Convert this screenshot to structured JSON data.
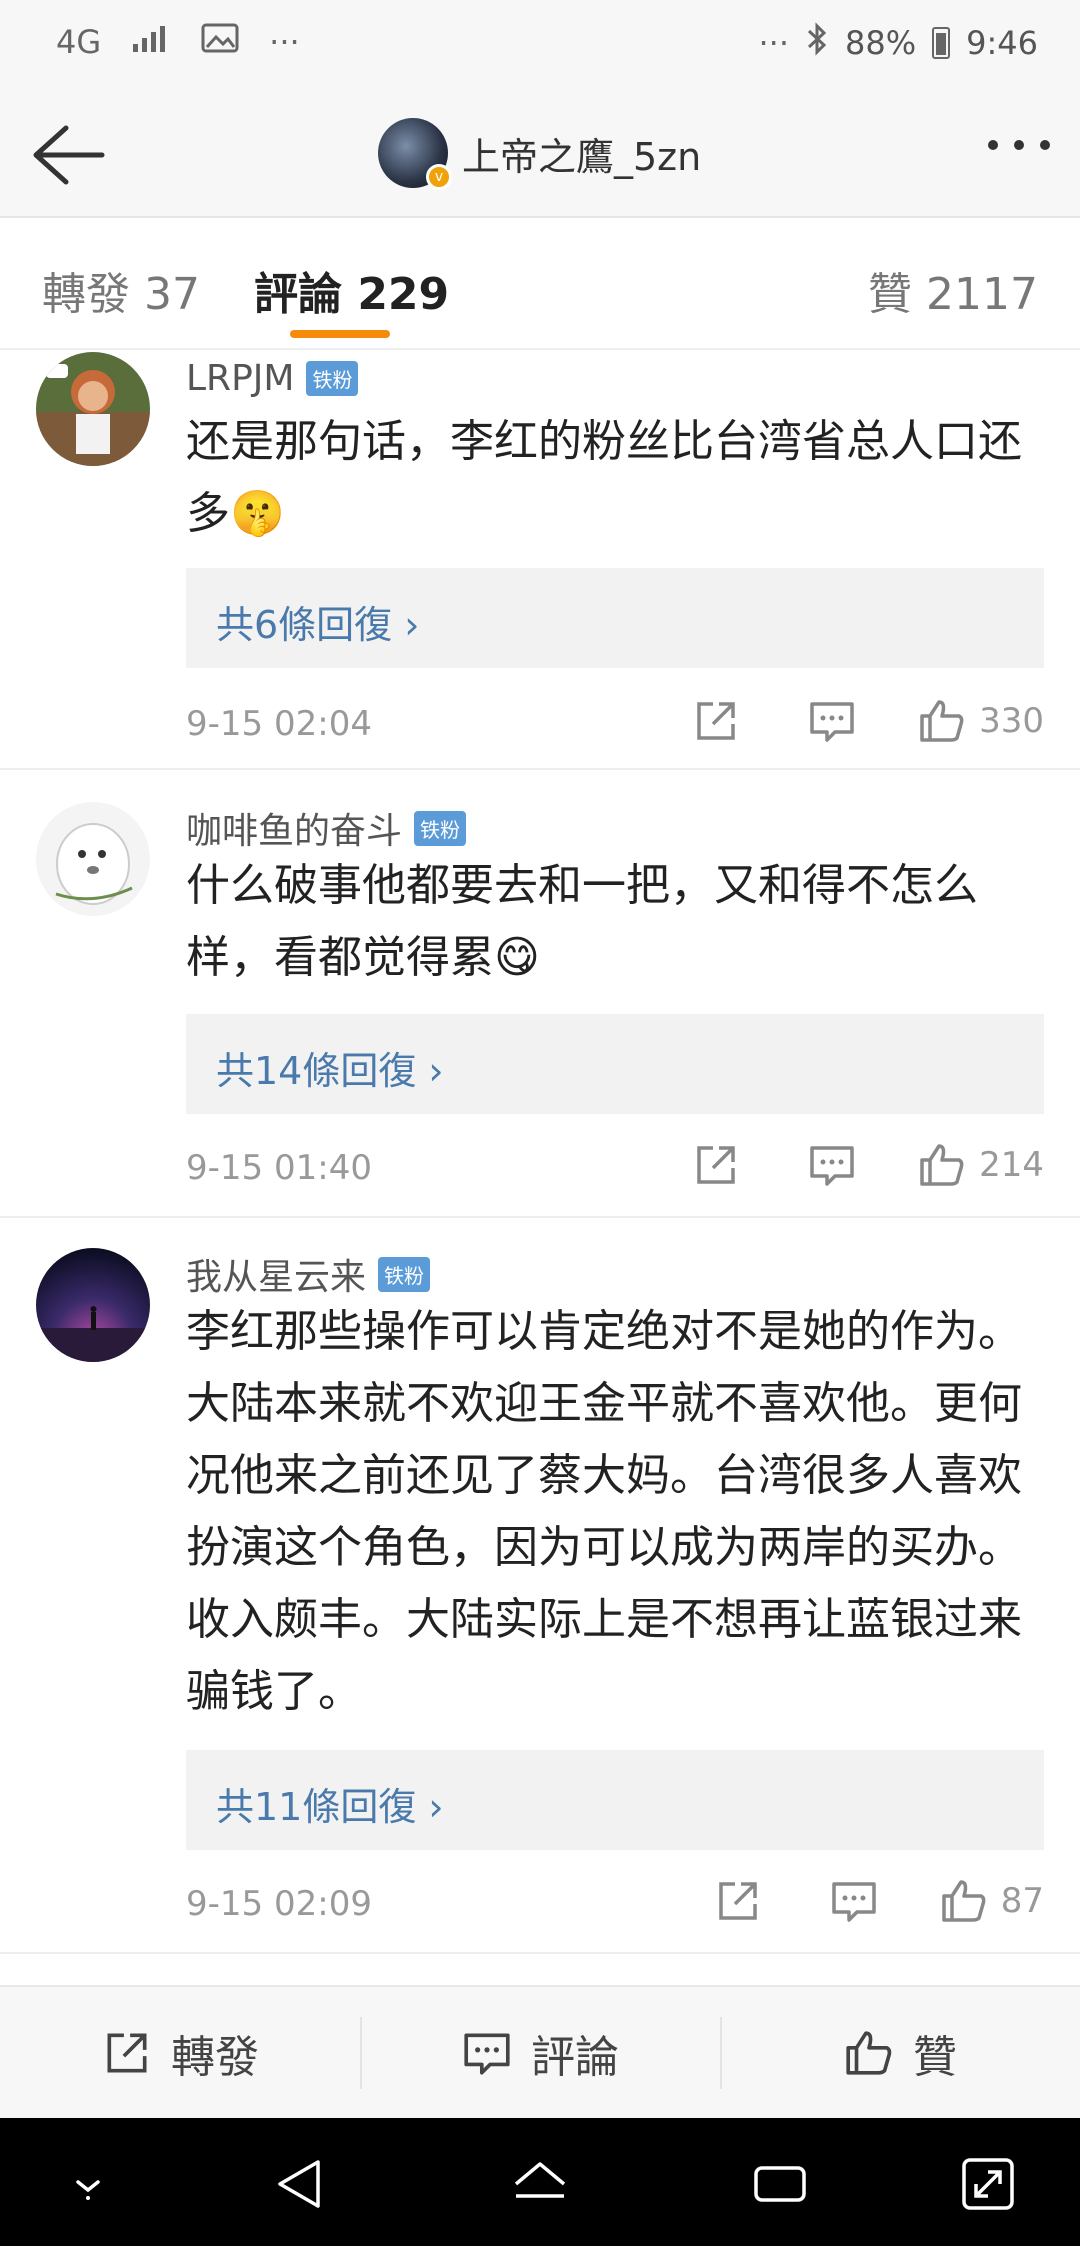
{
  "status_bar": {
    "network": "4G",
    "battery": "88%",
    "time": "9:46",
    "icons": [
      "signal-icon",
      "image-icon",
      "more-icon",
      "bluetooth-icon",
      "battery-icon"
    ]
  },
  "nav": {
    "title": "上帝之鷹_5zn",
    "back_icon": "back-arrow-icon",
    "more_icon": "more-dots-icon"
  },
  "tabs": {
    "reposts": "轉發 37",
    "comments": "評論 229",
    "likes": "贊 2117"
  },
  "comments": [
    {
      "name": "LRPJM",
      "badge": "铁粉",
      "line1": "还是那句话，李红的粉丝比台湾省总人口还",
      "line2": "多",
      "emoji": "🤫",
      "replies": "共6條回復 ›",
      "time": "9-15 02:04",
      "likes": "330"
    },
    {
      "name": "咖啡鱼的奋斗",
      "badge": "铁粉",
      "line1": "什么破事他都要去和一把，又和得不怎么",
      "line2": "样，看都觉得累",
      "emoji": "😋",
      "replies": "共14條回復 ›",
      "time": "9-15 01:40",
      "likes": "214"
    },
    {
      "name": "我从星云来",
      "badge": "铁粉",
      "line1": "李红那些操作可以肯定绝对不是她的作为。",
      "line2": "大陆本来就不欢迎王金平就不喜欢他。更何",
      "line3": "况他来之前还见了蔡大妈。台湾很多人喜欢",
      "line4": "扮演这个角色，因为可以成为两岸的买办。",
      "line5": "收入颇丰。大陆实际上是不想再让蓝银过来",
      "line6": "骗钱了。",
      "replies": "共11條回復 ›",
      "time": "9-15 02:09",
      "likes": "87"
    }
  ],
  "bottom_bar": {
    "repost": "轉發",
    "comment": "評論",
    "like": "贊"
  }
}
